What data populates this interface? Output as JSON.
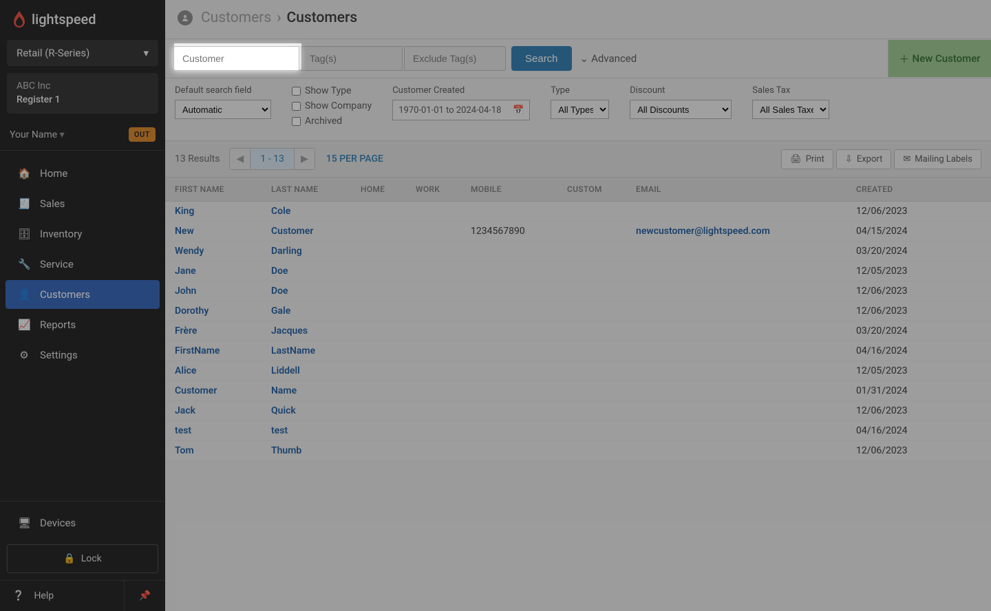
{
  "brand": "lightspeed",
  "productSelector": "Retail (R-Series)",
  "store": {
    "company": "ABC Inc",
    "register": "Register 1"
  },
  "user": {
    "name": "Your Name",
    "status": "OUT"
  },
  "nav": {
    "home": "Home",
    "sales": "Sales",
    "inventory": "Inventory",
    "service": "Service",
    "customers": "Customers",
    "reports": "Reports",
    "settings": "Settings",
    "devices": "Devices",
    "lock": "Lock",
    "help": "Help"
  },
  "breadcrumb": {
    "parent": "Customers",
    "current": "Customers"
  },
  "search": {
    "customer_placeholder": "Customer",
    "tags_placeholder": "Tag(s)",
    "exclude_placeholder": "Exclude Tag(s)",
    "search_btn": "Search",
    "advanced": "Advanced",
    "new_customer": "New Customer"
  },
  "filters": {
    "default_label": "Default search field",
    "default_value": "Automatic",
    "show_type": "Show Type",
    "show_company": "Show Company",
    "archived": "Archived",
    "created_label": "Customer Created",
    "created_value": "1970-01-01 to 2024-04-18",
    "type_label": "Type",
    "type_value": "All Types",
    "discount_label": "Discount",
    "discount_value": "All Discounts",
    "salestax_label": "Sales Tax",
    "salestax_value": "All Sales Taxes"
  },
  "results": {
    "count": "13 Results",
    "range": "1 - 13",
    "perpage": "15 PER PAGE",
    "print": "Print",
    "export": "Export",
    "mailing": "Mailing Labels"
  },
  "columns": {
    "first": "FIRST NAME",
    "last": "LAST NAME",
    "home": "HOME",
    "work": "WORK",
    "mobile": "MOBILE",
    "custom": "CUSTOM",
    "email": "EMAIL",
    "created": "CREATED"
  },
  "rows": [
    {
      "first": "King",
      "last": "Cole",
      "home": "",
      "work": "",
      "mobile": "",
      "custom": "",
      "email": "",
      "created": "12/06/2023"
    },
    {
      "first": "New",
      "last": "Customer",
      "home": "",
      "work": "",
      "mobile": "1234567890",
      "custom": "",
      "email": "newcustomer@lightspeed.com",
      "created": "04/15/2024"
    },
    {
      "first": "Wendy",
      "last": "Darling",
      "home": "",
      "work": "",
      "mobile": "",
      "custom": "",
      "email": "",
      "created": "03/20/2024"
    },
    {
      "first": "Jane",
      "last": "Doe",
      "home": "",
      "work": "",
      "mobile": "",
      "custom": "",
      "email": "",
      "created": "12/05/2023"
    },
    {
      "first": "John",
      "last": "Doe",
      "home": "",
      "work": "",
      "mobile": "",
      "custom": "",
      "email": "",
      "created": "12/06/2023"
    },
    {
      "first": "Dorothy",
      "last": "Gale",
      "home": "",
      "work": "",
      "mobile": "",
      "custom": "",
      "email": "",
      "created": "12/06/2023"
    },
    {
      "first": "Frère",
      "last": "Jacques",
      "home": "",
      "work": "",
      "mobile": "",
      "custom": "",
      "email": "",
      "created": "03/20/2024"
    },
    {
      "first": "FirstName",
      "last": "LastName",
      "home": "",
      "work": "",
      "mobile": "",
      "custom": "",
      "email": "",
      "created": "04/16/2024"
    },
    {
      "first": "Alice",
      "last": "Liddell",
      "home": "",
      "work": "",
      "mobile": "",
      "custom": "",
      "email": "",
      "created": "12/05/2023"
    },
    {
      "first": "Customer",
      "last": "Name",
      "home": "",
      "work": "",
      "mobile": "",
      "custom": "",
      "email": "",
      "created": "01/31/2024"
    },
    {
      "first": "Jack",
      "last": "Quick",
      "home": "",
      "work": "",
      "mobile": "",
      "custom": "",
      "email": "",
      "created": "12/06/2023"
    },
    {
      "first": "test",
      "last": "test",
      "home": "",
      "work": "",
      "mobile": "",
      "custom": "",
      "email": "",
      "created": "04/16/2024"
    },
    {
      "first": "Tom",
      "last": "Thumb",
      "home": "",
      "work": "",
      "mobile": "",
      "custom": "",
      "email": "",
      "created": "12/06/2023"
    }
  ]
}
